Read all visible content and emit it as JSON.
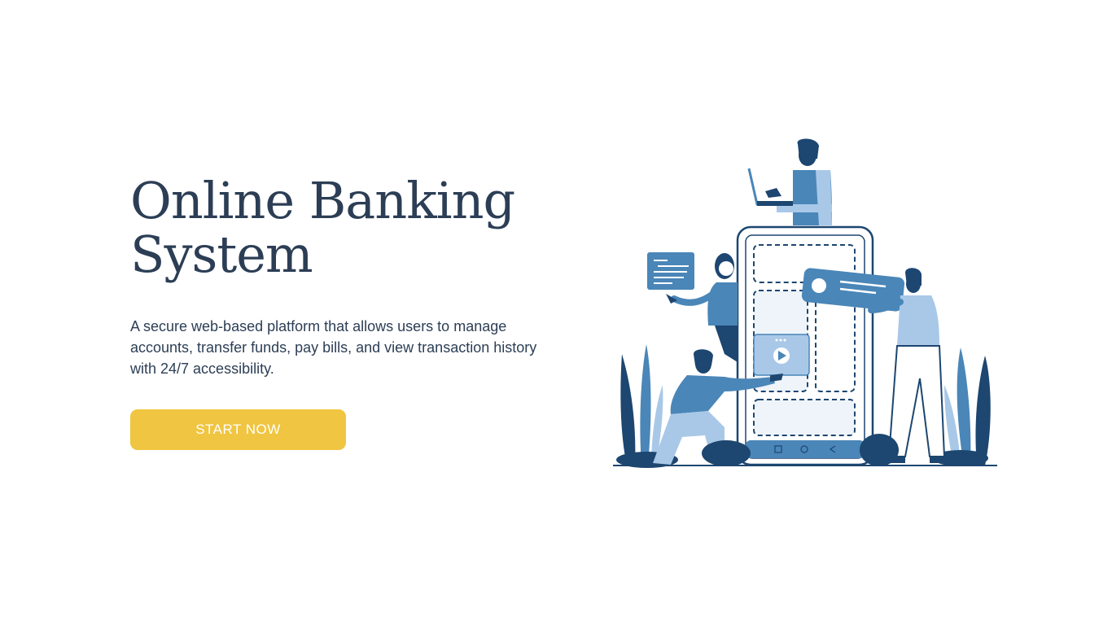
{
  "hero": {
    "title_line1": "Online Banking",
    "title_line2": "System",
    "description": "A secure web-based platform that allows users to manage accounts, transfer funds, pay bills, and view transaction history with 24/7 accessibility.",
    "cta_label": "START NOW"
  },
  "colors": {
    "title": "#2c3e55",
    "button": "#f0c541",
    "button_text": "#ffffff",
    "illustration_dark": "#1d4670",
    "illustration_mid": "#4a86b8",
    "illustration_light": "#a9c8e8"
  }
}
